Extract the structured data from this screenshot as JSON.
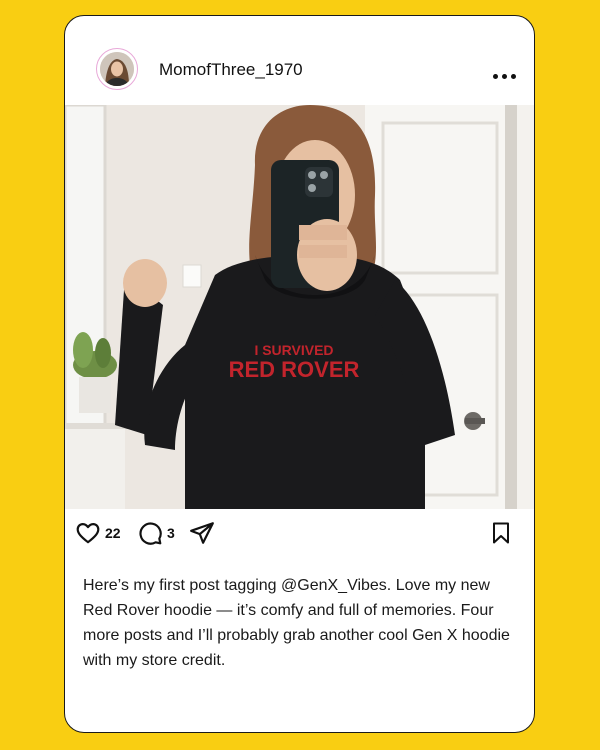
{
  "post": {
    "username": "MomofThree_1970",
    "photo_text": {
      "line1": "I SURVIVED",
      "line2": "RED ROVER"
    },
    "likes": "22",
    "comments": "3",
    "caption": "Here’s my first post tagging @GenX_Vibes. Love my new Red Rover hoodie — it’s comfy and full of memories. Four more posts and I’ll probably grab another cool Gen X hoodie with my store credit."
  },
  "icons": {
    "more": "more-horizontal-icon",
    "like": "heart-icon",
    "comment": "comment-icon",
    "share": "send-icon",
    "save": "bookmark-icon"
  },
  "colors": {
    "background": "#F9CE12",
    "hoodie_text": "#C2242C"
  }
}
